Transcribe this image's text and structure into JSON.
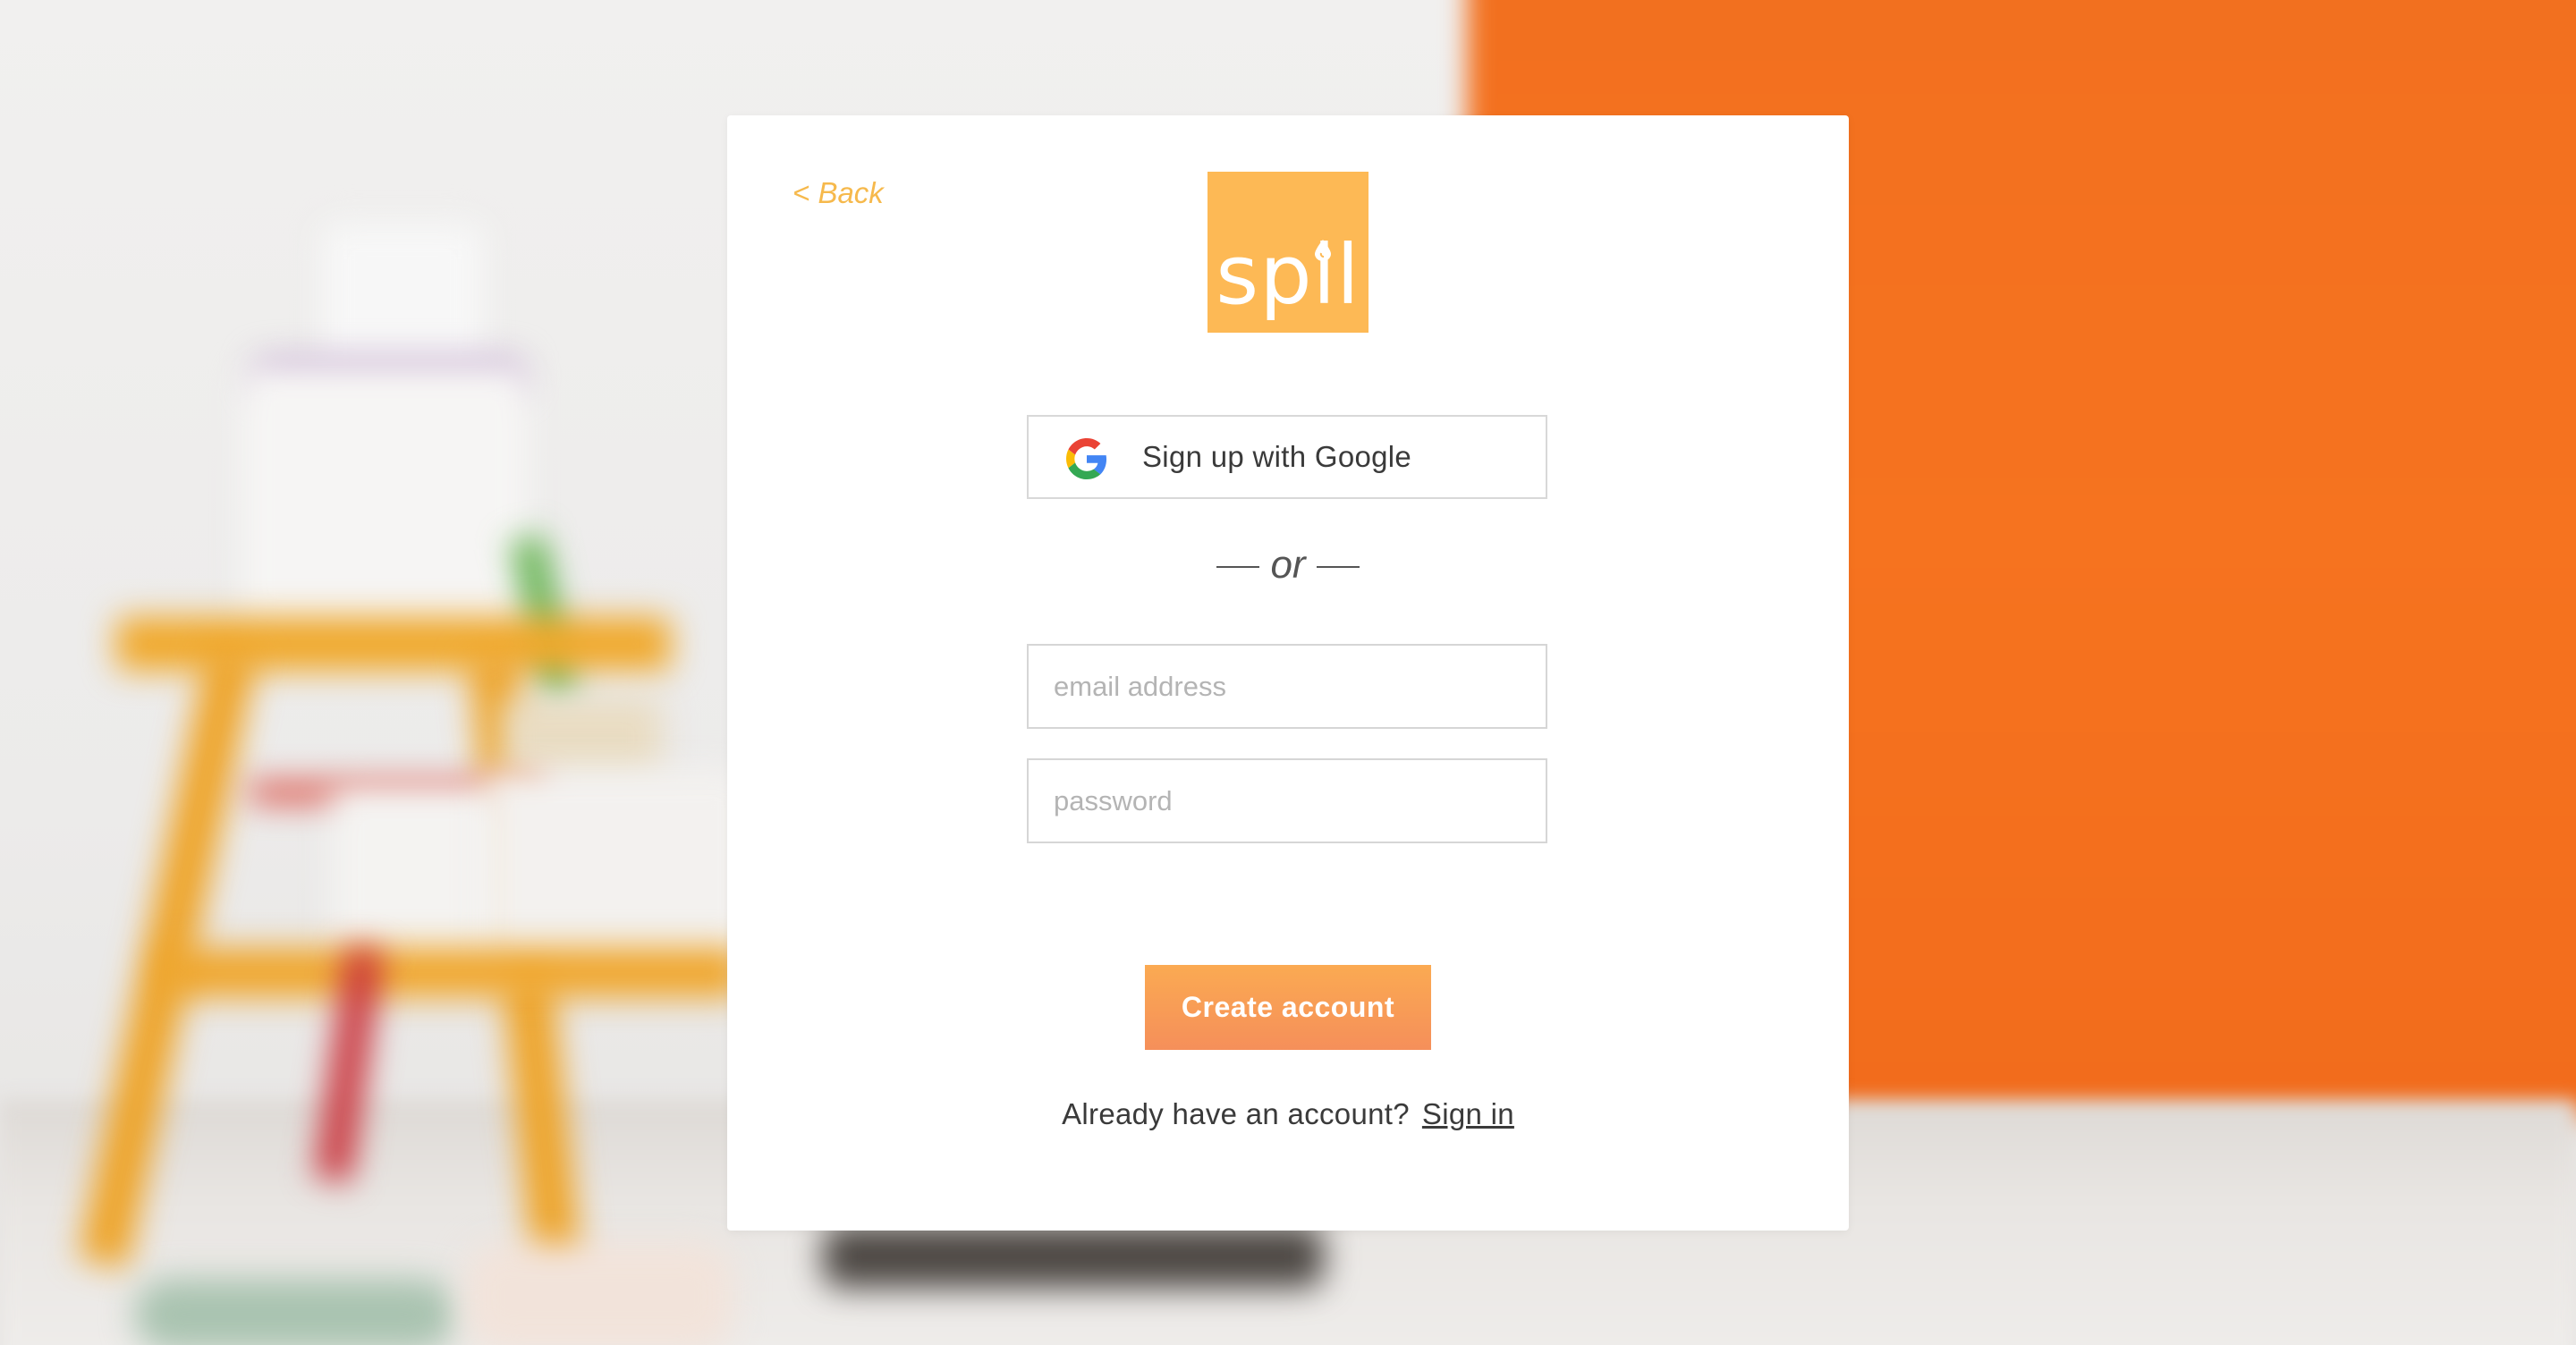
{
  "card": {
    "back_label": "< Back",
    "logo_text": "spil",
    "google_button_label": "Sign up with Google",
    "or_label": "or",
    "email_placeholder": "email address",
    "password_placeholder": "password",
    "create_button_label": "Create account",
    "signin_prompt": "Already have an account?",
    "signin_link_label": "Sign in"
  },
  "icons": {
    "logo_drop": "paint-drop-icon",
    "google": "google-g-icon"
  },
  "colors": {
    "brand_orange": "#fdb955",
    "back_link": "#f6b94c",
    "button_gradient_top": "#fbaa52",
    "button_gradient_bottom": "#f58f5a",
    "background_orange": "#f6731f"
  }
}
